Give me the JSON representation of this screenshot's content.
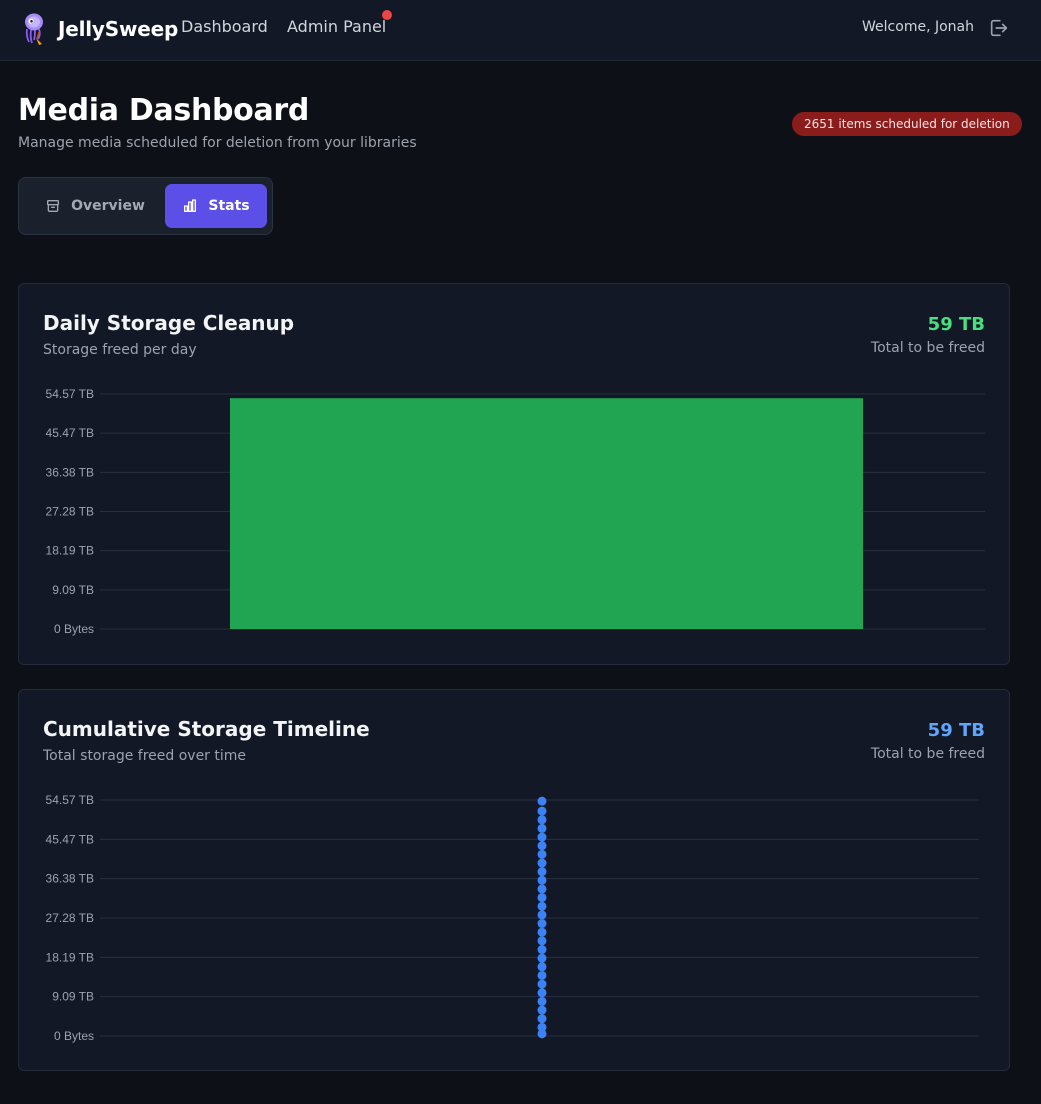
{
  "nav": {
    "brand": "JellySweep",
    "links": {
      "dashboard": "Dashboard",
      "admin": "Admin Panel"
    },
    "welcome": "Welcome, Jonah"
  },
  "header": {
    "title": "Media Dashboard",
    "subtitle": "Manage media scheduled for deletion from your libraries",
    "badge": "2651 items scheduled for deletion"
  },
  "tabs": [
    {
      "label": "Overview",
      "active": false
    },
    {
      "label": "Stats",
      "active": true
    }
  ],
  "colors": {
    "accent": "#5b4fe8",
    "green": "#22a552",
    "green_text": "#4ade80",
    "blue": "#3b82f6",
    "blue_text": "#60a5fa",
    "badge": "#8b1c1c"
  },
  "cards": {
    "daily": {
      "title": "Daily Storage Cleanup",
      "subtitle": "Storage freed per day",
      "total": "59 TB",
      "total_label": "Total to be freed"
    },
    "cumulative": {
      "title": "Cumulative Storage Timeline",
      "subtitle": "Total storage freed over time",
      "total": "59 TB",
      "total_label": "Total to be freed"
    }
  },
  "chart_data": [
    {
      "type": "bar",
      "title": "Daily Storage Cleanup",
      "yticks": [
        "0 Bytes",
        "9.09 TB",
        "18.19 TB",
        "27.28 TB",
        "36.38 TB",
        "45.47 TB",
        "54.57 TB"
      ],
      "ylim": [
        0,
        54.57
      ],
      "categories": [
        ""
      ],
      "values": [
        53.6
      ],
      "unit": "TB",
      "grid": true
    },
    {
      "type": "scatter",
      "title": "Cumulative Storage Timeline",
      "yticks": [
        "0 Bytes",
        "9.09 TB",
        "18.19 TB",
        "27.28 TB",
        "36.38 TB",
        "45.47 TB",
        "54.57 TB"
      ],
      "ylim": [
        0,
        54.57
      ],
      "y": [
        0.5,
        2,
        4,
        6,
        8,
        10,
        12,
        14,
        16,
        18,
        20,
        22,
        24,
        26,
        28,
        30,
        32,
        34,
        36,
        38,
        40,
        42,
        44,
        46,
        48,
        50,
        52,
        54.3
      ],
      "unit": "TB",
      "grid": true
    }
  ]
}
